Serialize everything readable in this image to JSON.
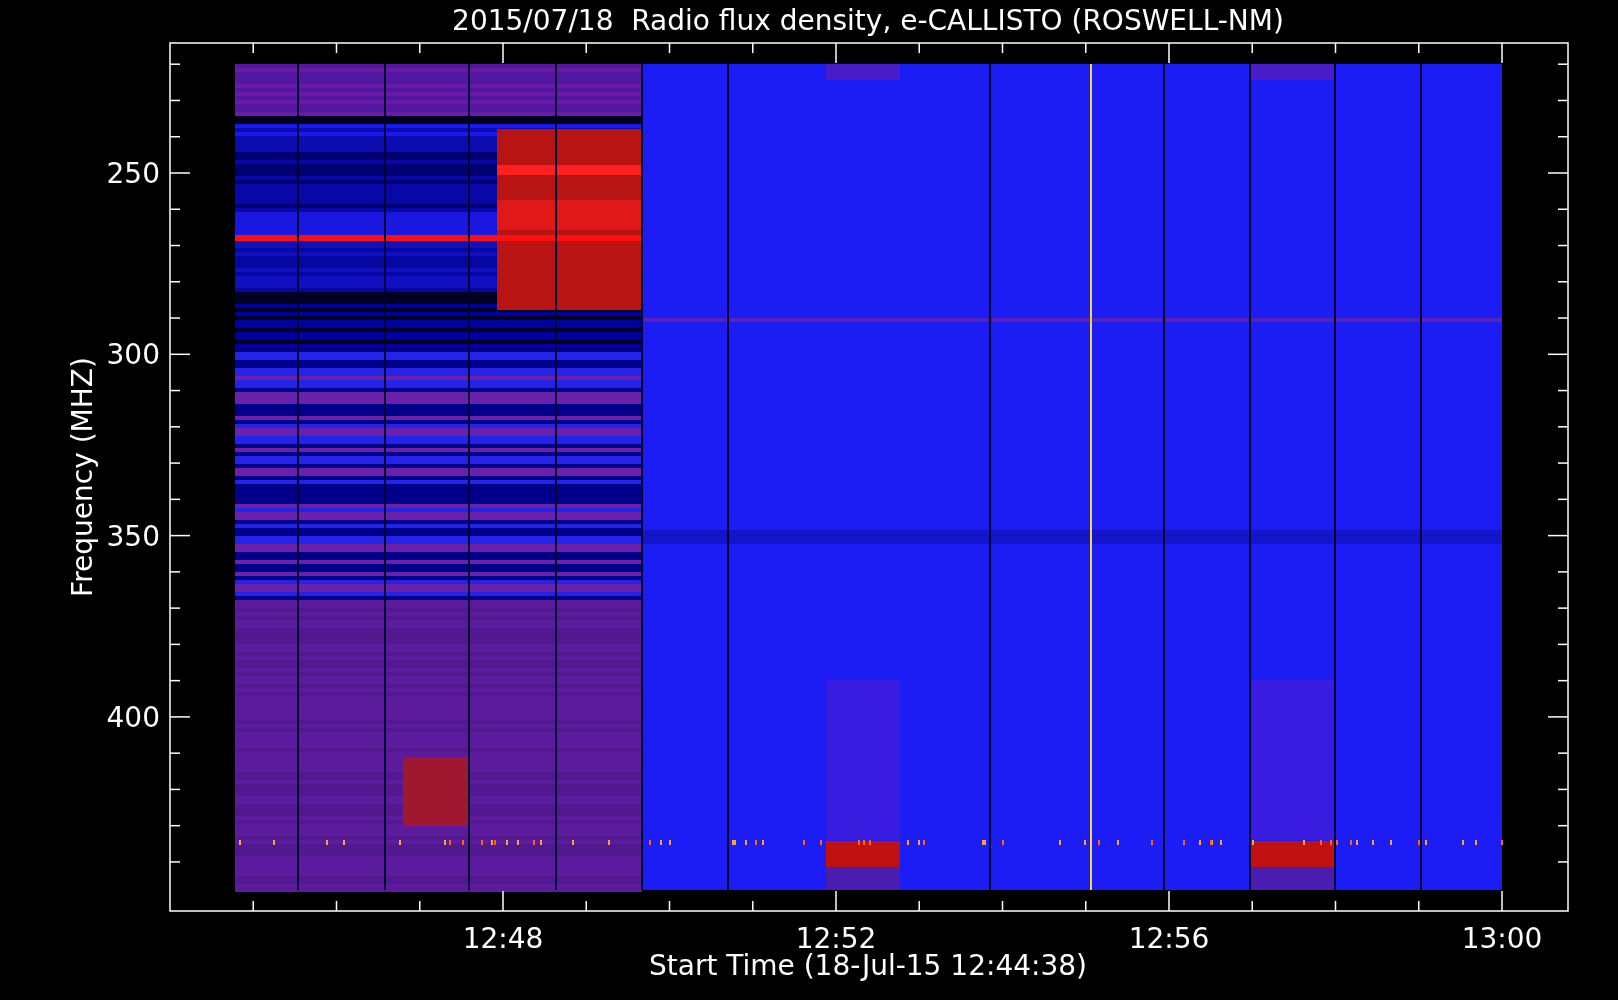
{
  "title": "2015/07/18  Radio flux density, e-CALLISTO (ROSWELL-NM)",
  "plot": {
    "ylabel": "Frequency (MHZ)",
    "xlabel": "Start Time (18-Jul-15 12:44:38)",
    "yticks": [
      "250",
      "300",
      "350",
      "400"
    ],
    "xticks": [
      "12:48",
      "12:52",
      "12:56",
      "13:00"
    ]
  }
}
